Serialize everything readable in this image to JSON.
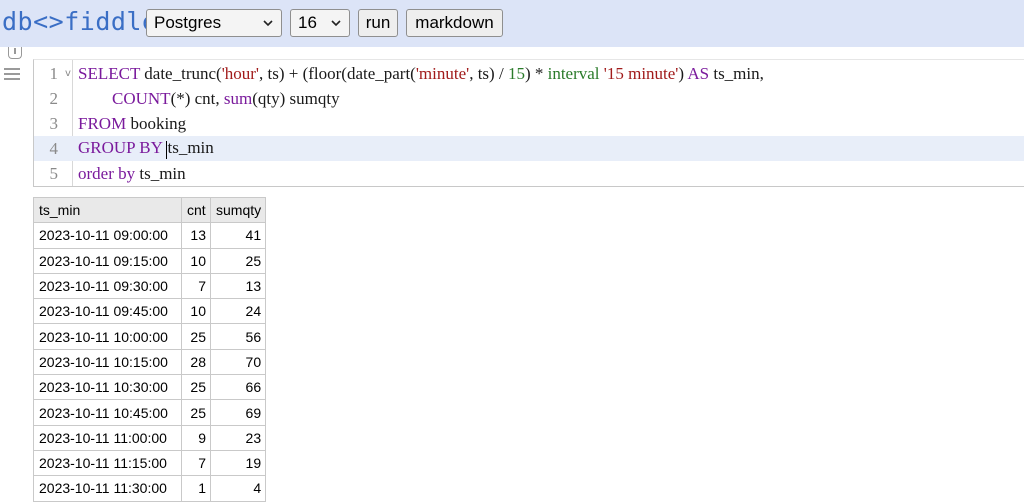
{
  "header": {
    "logo": {
      "part1": "db",
      "part2": "<>",
      "part3": "fiddle"
    },
    "db_select": "Postgres",
    "version_select": "16",
    "run_label": "run",
    "markdown_label": "markdown"
  },
  "editor": {
    "lines": [
      {
        "num": "1",
        "fold": "v"
      },
      {
        "num": "2"
      },
      {
        "num": "3"
      },
      {
        "num": "4"
      },
      {
        "num": "5"
      }
    ],
    "tokens": {
      "l1": {
        "select": "SELECT",
        "t1": " date_trunc(",
        "s1": "'hour'",
        "t2": ", ts) + (floor(date_part(",
        "s2": "'minute'",
        "t3": ", ts) / ",
        "n1": "15",
        "t4": ") * ",
        "interval": "interval",
        "t5": " ",
        "s3": "'15 minute'",
        "t6": ") ",
        "as": "AS",
        "t7": " ts_min,"
      },
      "l2": {
        "indent": "        ",
        "count": "COUNT",
        "t1": "(*) cnt, ",
        "sum": "sum",
        "t2": "(qty) sumqty"
      },
      "l3": {
        "from": "FROM",
        "t1": " booking"
      },
      "l4": {
        "groupby": "GROUP BY",
        "t1": " ",
        "t2": "ts_min"
      },
      "l5": {
        "orderby": "order by",
        "t1": " ts_min"
      }
    }
  },
  "result": {
    "columns": [
      "ts_min",
      "cnt",
      "sumqty"
    ],
    "rows": [
      [
        "2023-10-11 09:00:00",
        "13",
        "41"
      ],
      [
        "2023-10-11 09:15:00",
        "10",
        "25"
      ],
      [
        "2023-10-11 09:30:00",
        "7",
        "13"
      ],
      [
        "2023-10-11 09:45:00",
        "10",
        "24"
      ],
      [
        "2023-10-11 10:00:00",
        "25",
        "56"
      ],
      [
        "2023-10-11 10:15:00",
        "28",
        "70"
      ],
      [
        "2023-10-11 10:30:00",
        "25",
        "66"
      ],
      [
        "2023-10-11 10:45:00",
        "25",
        "69"
      ],
      [
        "2023-10-11 11:00:00",
        "9",
        "23"
      ],
      [
        "2023-10-11 11:15:00",
        "7",
        "19"
      ],
      [
        "2023-10-11 11:30:00",
        "1",
        "4"
      ]
    ]
  }
}
